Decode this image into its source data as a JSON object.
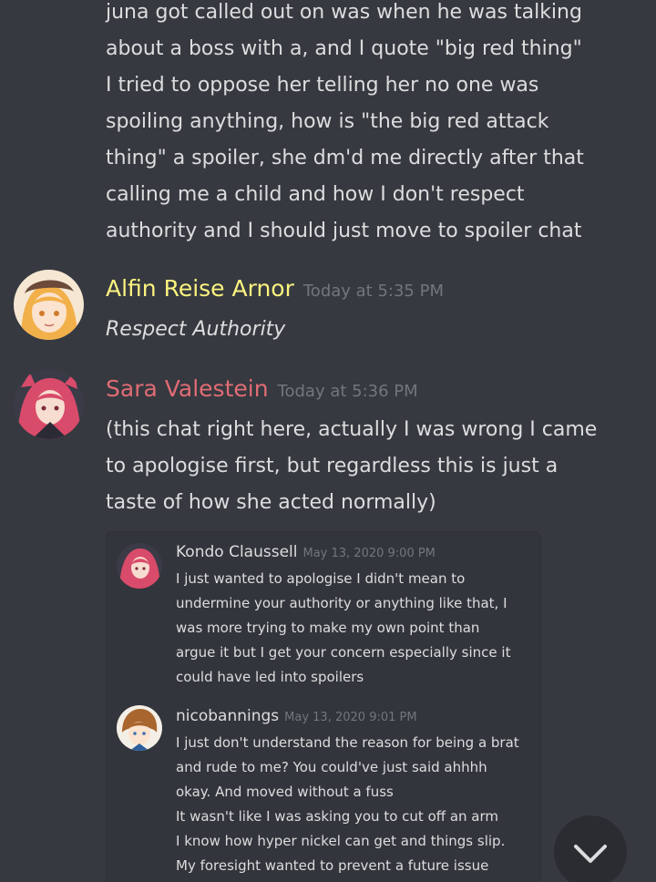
{
  "continued_message": {
    "lines": [
      "juna got called out on was when he was talking",
      "about a boss with a, and I quote \"big red thing\"",
      "I tried to oppose her telling her no one was",
      "spoiling anything, how is \"the big red attack",
      "thing\" a spoiler, she dm'd me directly after that",
      "calling me a child and how I don't respect",
      "authority and I should just move to spoiler chat"
    ]
  },
  "messages": [
    {
      "author": "Alfin Reise Arnor",
      "author_color": "#fcf37f",
      "timestamp": "Today at 5:35 PM",
      "text": "Respect Authority",
      "avatar": "blonde-character-avatar"
    },
    {
      "author": "Sara Valestein",
      "author_color": "#e06c75",
      "timestamp": "Today at 5:36 PM",
      "lines": [
        "(this chat right here, actually I was wrong I came",
        "to apologise first, but regardless this is just a",
        "taste of how she acted normally)"
      ],
      "avatar": "red-haired-character-avatar"
    }
  ],
  "embedded_screenshot": {
    "messages": [
      {
        "author": "Kondo Claussell",
        "timestamp": "May 13, 2020 9:00 PM",
        "lines": [
          "I just wanted to apologise I didn't mean to",
          "undermine your authority or anything like that, I",
          "was more trying to make my own point than",
          "argue it but I get your concern especially since it",
          "could have led into spoilers"
        ]
      },
      {
        "author": "nicobannings",
        "timestamp": "May 13, 2020 9:01 PM",
        "lines": [
          "I just don't understand the reason for being a brat",
          "and rude to me? You could've just said ahhhh",
          "okay. And moved without a fuss",
          "It wasn't like I was asking you to cut off an arm",
          "I know how hyper nickel can get and things slip.",
          "My foresight wanted to prevent a future issue"
        ]
      }
    ]
  },
  "scroll_button": {
    "icon": "chevron-down-icon"
  },
  "colors": {
    "background": "#36393f",
    "text": "#dcddde",
    "muted": "#72767d"
  }
}
